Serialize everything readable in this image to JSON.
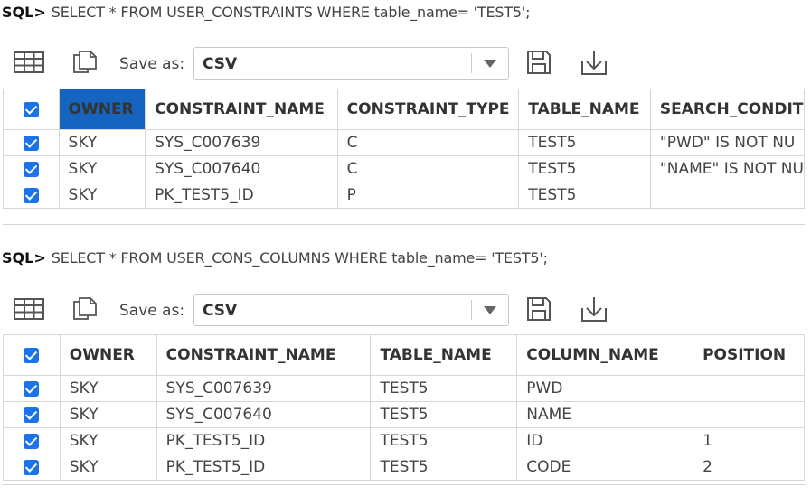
{
  "query1": {
    "prompt": "SQL>",
    "text": "SELECT * FROM USER_CONSTRAINTS WHERE table_name= 'TEST5';",
    "toolbar": {
      "save_as_label": "Save as:",
      "format": "CSV"
    },
    "columns": [
      "OWNER",
      "CONSTRAINT_NAME",
      "CONSTRAINT_TYPE",
      "TABLE_NAME",
      "SEARCH_CONDIT"
    ],
    "rows": [
      [
        "SKY",
        "SYS_C007639",
        "C",
        "TEST5",
        "\"PWD\" IS NOT NU"
      ],
      [
        "SKY",
        "SYS_C007640",
        "C",
        "TEST5",
        "\"NAME\" IS NOT NU"
      ],
      [
        "SKY",
        "PK_TEST5_ID",
        "P",
        "TEST5",
        ""
      ]
    ]
  },
  "query2": {
    "prompt": "SQL>",
    "text": "SELECT * FROM USER_CONS_COLUMNS WHERE table_name= 'TEST5';",
    "toolbar": {
      "save_as_label": "Save as:",
      "format": "CSV"
    },
    "columns": [
      "OWNER",
      "CONSTRAINT_NAME",
      "TABLE_NAME",
      "COLUMN_NAME",
      "POSITION"
    ],
    "rows": [
      [
        "SKY",
        "SYS_C007639",
        "TEST5",
        "PWD",
        ""
      ],
      [
        "SKY",
        "SYS_C007640",
        "TEST5",
        "NAME",
        ""
      ],
      [
        "SKY",
        "PK_TEST5_ID",
        "TEST5",
        "ID",
        "1"
      ],
      [
        "SKY",
        "PK_TEST5_ID",
        "TEST5",
        "CODE",
        "2"
      ]
    ]
  },
  "colors": {
    "accent": "#1a73e8",
    "selected_header": "#1565c0",
    "border": "#d6d6d6"
  },
  "icons": [
    "grid-view-icon",
    "copy-icon",
    "chevron-down-icon",
    "save-icon",
    "download-icon",
    "checkbox-checked-icon"
  ]
}
